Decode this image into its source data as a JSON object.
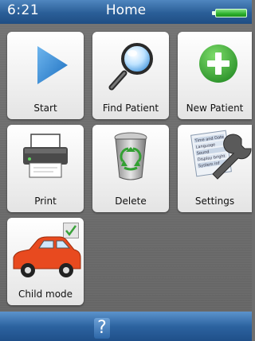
{
  "status_bar": {
    "time": "6:21",
    "title": "Home"
  },
  "tiles": [
    {
      "label": "Start",
      "icon": "play-icon"
    },
    {
      "label": "Find Patient",
      "icon": "magnifier-icon"
    },
    {
      "label": "New Patient",
      "icon": "plus-circle-icon"
    },
    {
      "label": "Print",
      "icon": "printer-icon"
    },
    {
      "label": "Delete",
      "icon": "recycle-bin-icon"
    },
    {
      "label": "Settings",
      "icon": "wrench-settings-icon"
    },
    {
      "label": "Child mode",
      "icon": "car-icon",
      "checked": true
    }
  ],
  "settings_doc_lines": [
    "Time and Date",
    "Language",
    "Sound",
    "Display bright",
    "System inf"
  ],
  "bottom_bar": {
    "help_label": "?"
  },
  "colors": {
    "status_bar": "#2a5e97",
    "battery": "#2cb02c",
    "play": "#2f86d4",
    "new_patient": "#35a535",
    "car": "#e84a1f",
    "check": "#3aa23a"
  }
}
